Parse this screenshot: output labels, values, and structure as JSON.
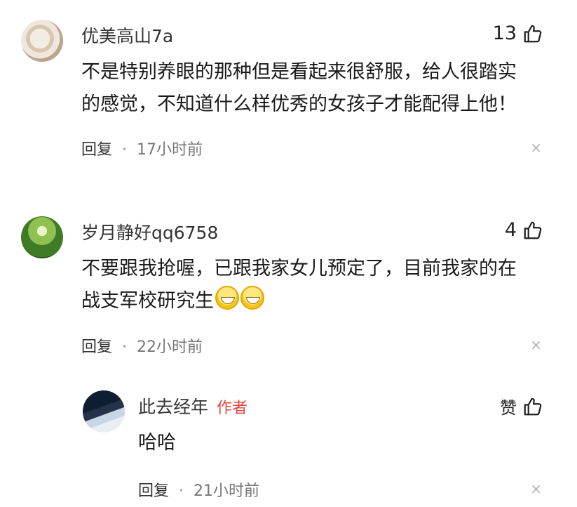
{
  "comments": [
    {
      "username": "优美高山7a",
      "likes": "13",
      "text_line1": "不是特别养眼的那种但是看起来很舒服，给人很踏实",
      "text_line2": "的感觉，不知道什么样优秀的女孩子才能配得上他！",
      "reply_label": "回复",
      "time": "17小时前"
    },
    {
      "username": "岁月静好qq6758",
      "likes": "4",
      "text_line1": "不要跟我抢喔，已跟我家女儿预定了，目前我家的在",
      "text_line2": "战支军校研究生",
      "reply_label": "回复",
      "time": "22小时前",
      "emoji_count": 2
    }
  ],
  "reply": {
    "username": "此去经年",
    "author_tag": "作者",
    "likes": "赞",
    "text": "哈哈",
    "reply_label": "回复",
    "time": "21小时前"
  },
  "separator": "·",
  "close_symbol": "×",
  "icons": [
    "thumb-up-icon",
    "close-icon",
    "grin-emoji-icon"
  ]
}
